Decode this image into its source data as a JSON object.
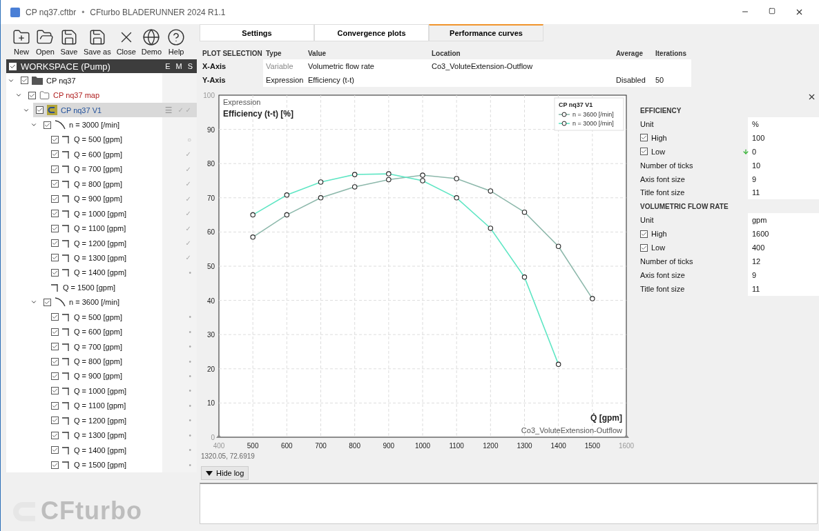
{
  "window": {
    "title": "CP nq37.cftbr",
    "separator": "•",
    "app": "CFturbo BLADERUNNER 2024 R1.1"
  },
  "toolbar": [
    {
      "label": "New",
      "kind": "new"
    },
    {
      "label": "Open",
      "kind": "open"
    },
    {
      "label": "Save",
      "kind": "save"
    },
    {
      "label": "Save as",
      "kind": "save"
    },
    {
      "label": "Close",
      "kind": "close"
    },
    {
      "label": "Demo",
      "kind": "globe"
    },
    {
      "label": "Help",
      "kind": "help"
    }
  ],
  "workspace": {
    "title": "WORKSPACE (Pump)",
    "checked": true,
    "flags": [
      "E",
      "M",
      "S"
    ]
  },
  "tree": [
    {
      "label": "CP nq37",
      "kind": "project",
      "checked": true,
      "expanded": true,
      "selected": false,
      "children": [
        {
          "label": "CP nq37 map",
          "kind": "map",
          "checked": true,
          "expanded": true,
          "selected": false,
          "children": [
            {
              "label": "CP nq37 V1",
              "kind": "design",
              "checked": true,
              "expanded": true,
              "selected": true,
              "menu": "☰",
              "status": "✓ ✓",
              "children": [
                {
                  "label": "n = 3000 [/min]",
                  "kind": "speed",
                  "checked": true,
                  "expanded": true,
                  "selected": false,
                  "children": [
                    {
                      "label": "Q = 500 [gpm]",
                      "kind": "point",
                      "checked": true,
                      "selected": false,
                      "status": "○"
                    },
                    {
                      "label": "Q = 600 [gpm]",
                      "kind": "point",
                      "checked": true,
                      "selected": false,
                      "status": "✓"
                    },
                    {
                      "label": "Q = 700 [gpm]",
                      "kind": "point",
                      "checked": true,
                      "selected": false,
                      "status": "✓"
                    },
                    {
                      "label": "Q = 800 [gpm]",
                      "kind": "point",
                      "checked": true,
                      "selected": false,
                      "status": "✓"
                    },
                    {
                      "label": "Q = 900 [gpm]",
                      "kind": "point",
                      "checked": true,
                      "selected": false,
                      "status": "✓"
                    },
                    {
                      "label": "Q = 1000 [gpm]",
                      "kind": "point",
                      "checked": true,
                      "selected": false,
                      "status": "✓"
                    },
                    {
                      "label": "Q = 1100 [gpm]",
                      "kind": "point",
                      "checked": true,
                      "selected": false,
                      "status": "✓"
                    },
                    {
                      "label": "Q = 1200 [gpm]",
                      "kind": "point",
                      "checked": true,
                      "selected": false,
                      "status": "✓"
                    },
                    {
                      "label": "Q = 1300 [gpm]",
                      "kind": "point",
                      "checked": true,
                      "selected": false,
                      "status": "✓"
                    },
                    {
                      "label": "Q = 1400 [gpm]",
                      "kind": "point",
                      "checked": true,
                      "selected": false,
                      "status": "•"
                    },
                    {
                      "label": "Q = 1500 [gpm]",
                      "kind": "point",
                      "checkable": false,
                      "selected": false
                    }
                  ]
                },
                {
                  "label": "n = 3600 [/min]",
                  "kind": "speed",
                  "checked": true,
                  "expanded": true,
                  "selected": false,
                  "children": [
                    {
                      "label": "Q = 500 [gpm]",
                      "kind": "point",
                      "checked": true,
                      "selected": false,
                      "status": "•"
                    },
                    {
                      "label": "Q = 600 [gpm]",
                      "kind": "point",
                      "checked": true,
                      "selected": false,
                      "status": "•"
                    },
                    {
                      "label": "Q = 700 [gpm]",
                      "kind": "point",
                      "checked": true,
                      "selected": false,
                      "status": "•"
                    },
                    {
                      "label": "Q = 800 [gpm]",
                      "kind": "point",
                      "checked": true,
                      "selected": false,
                      "status": "•"
                    },
                    {
                      "label": "Q = 900 [gpm]",
                      "kind": "point",
                      "checked": true,
                      "selected": false,
                      "status": "•"
                    },
                    {
                      "label": "Q = 1000 [gpm]",
                      "kind": "point",
                      "checked": true,
                      "selected": false,
                      "status": "•"
                    },
                    {
                      "label": "Q = 1100 [gpm]",
                      "kind": "point",
                      "checked": true,
                      "selected": false,
                      "status": "•"
                    },
                    {
                      "label": "Q = 1200 [gpm]",
                      "kind": "point",
                      "checked": true,
                      "selected": false,
                      "status": "•"
                    },
                    {
                      "label": "Q = 1300 [gpm]",
                      "kind": "point",
                      "checked": true,
                      "selected": false,
                      "status": "•"
                    },
                    {
                      "label": "Q = 1400 [gpm]",
                      "kind": "point",
                      "checked": true,
                      "selected": false,
                      "status": "•"
                    },
                    {
                      "label": "Q = 1500 [gpm]",
                      "kind": "point",
                      "checked": true,
                      "selected": false,
                      "status": "•"
                    }
                  ]
                }
              ]
            }
          ]
        }
      ]
    }
  ],
  "brand_logo": {
    "text": "CFturbo"
  },
  "tabs": [
    {
      "label": "Settings",
      "selected": false
    },
    {
      "label": "Convergence plots",
      "selected": false
    },
    {
      "label": "Performance curves",
      "selected": true
    }
  ],
  "plot_selection": {
    "columns": [
      "PLOT SELECTION",
      "Type",
      "Value",
      "Location",
      "Average",
      "Iterations"
    ],
    "rows": [
      {
        "axis": "X-Axis",
        "type": "Variable",
        "type_disabled": true,
        "value": "Volumetric flow rate",
        "location": "Co3_VoluteExtension-Outflow"
      },
      {
        "axis": "Y-Axis",
        "type": "Expression",
        "type_disabled": false,
        "value": "Efficiency (t-t)",
        "average": "Disabled",
        "iterations": "50"
      }
    ]
  },
  "chart": {
    "y_source": "Expression",
    "x_source": "Co3_VoluteExtension-Outflow",
    "chart_data": {
      "type": "line",
      "ylabel": "Efficiency (t-t) [%]",
      "xlabel": "Q̇ [gpm]",
      "grid": true,
      "legend": {
        "title": "CP nq37 V1"
      },
      "x": [
        500,
        600,
        700,
        800,
        900,
        1000,
        1100,
        1200,
        1300,
        1400,
        1500
      ],
      "series": [
        {
          "name": "n = 3600 [/min]",
          "color": "#8db8ab",
          "marker": "circle",
          "values": [
            58.5,
            65,
            70,
            73.2,
            75.3,
            76.6,
            75.6,
            72,
            65.8,
            55.8,
            40.5
          ]
        },
        {
          "name": "n = 3000 [/min]",
          "color": "#5fe6c4",
          "marker": "circle",
          "values": [
            65,
            70.8,
            74.6,
            76.8,
            77,
            75,
            70,
            61.1,
            46.8,
            21.3,
            null
          ]
        }
      ],
      "xlim": [
        400,
        1600
      ],
      "ylim": [
        0,
        100
      ],
      "xticks": [
        400,
        500,
        600,
        700,
        800,
        900,
        1000,
        1100,
        1200,
        1300,
        1400,
        1500,
        1600
      ],
      "yticks": [
        0,
        10,
        20,
        30,
        40,
        50,
        60,
        70,
        80,
        90,
        100
      ]
    },
    "cursor_readout": "1320.05, 72.6919"
  },
  "log": {
    "toggle": "Hide log",
    "expanded": true
  },
  "axis_settings": [
    {
      "title": "EFFICIENCY",
      "rows": [
        {
          "label": "Unit",
          "value": "%"
        },
        {
          "label": "High",
          "value": "100",
          "checked": true
        },
        {
          "label": "Low",
          "value": "0",
          "checked": true,
          "adjusted": true
        },
        {
          "label": "Number of ticks",
          "value": "10"
        },
        {
          "label": "Axis font size",
          "value": "9"
        },
        {
          "label": "Title font size",
          "value": "11"
        }
      ]
    },
    {
      "title": "VOLUMETRIC FLOW RATE",
      "rows": [
        {
          "label": "Unit",
          "value": "gpm"
        },
        {
          "label": "High",
          "value": "1600",
          "checked": true
        },
        {
          "label": "Low",
          "value": "400",
          "checked": true
        },
        {
          "label": "Number of ticks",
          "value": "12"
        },
        {
          "label": "Axis font size",
          "value": "9"
        },
        {
          "label": "Title font size",
          "value": "11"
        }
      ]
    }
  ]
}
